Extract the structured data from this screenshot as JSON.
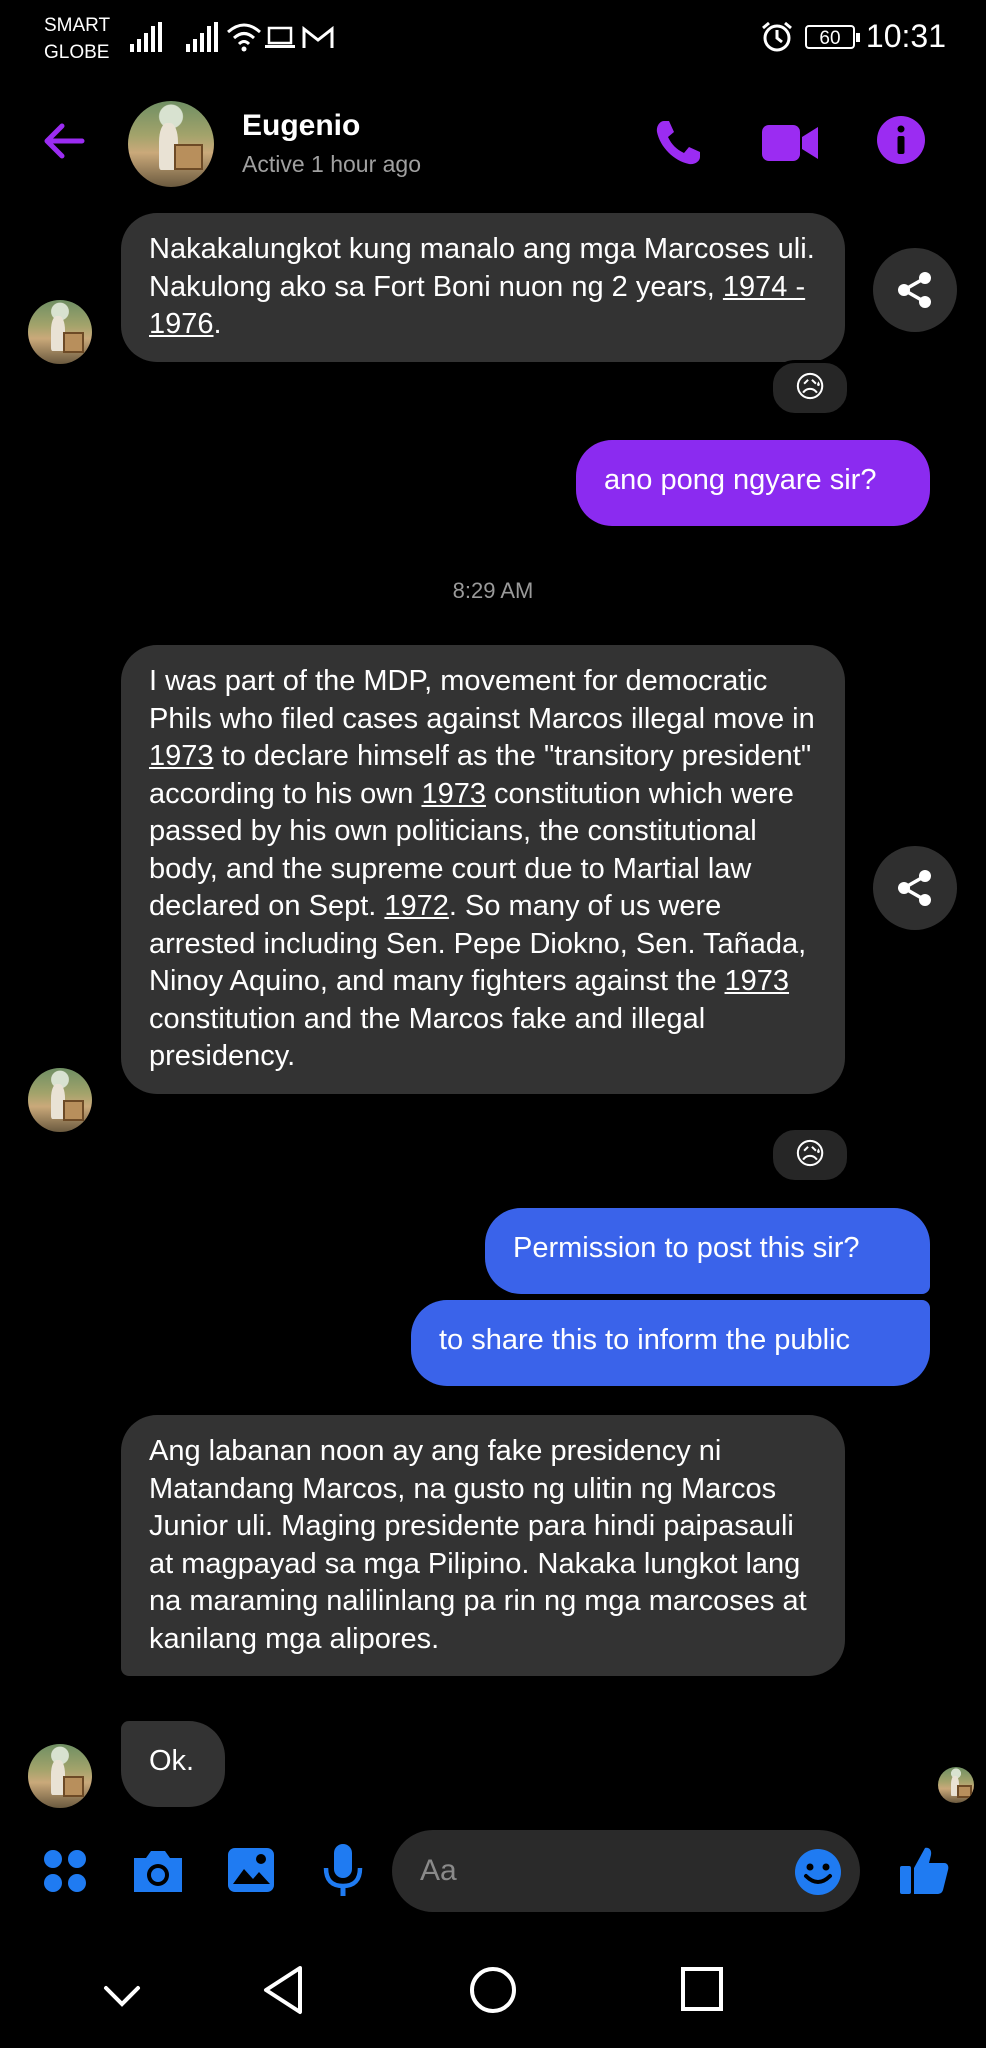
{
  "status_bar": {
    "carrier_line1": "SMART",
    "carrier_line2": "GLOBE",
    "battery": "60",
    "time": "10:31"
  },
  "header": {
    "contact_name": "Eugenio",
    "contact_status": "Active 1 hour ago",
    "accent_color": "#9b2cf2"
  },
  "messages": {
    "m1": {
      "parts": [
        "Nakakalungkot kung manalo ang mga Marcoses uli. Nakulong ako sa Fort Boni nuon ng 2 years, ",
        "1974 - 1976",
        "."
      ],
      "reaction": "😥"
    },
    "m2": {
      "text": "ano pong ngyare sir?"
    },
    "timestamp": "8:29 AM",
    "m3": {
      "parts": [
        "I was part of the MDP, movement for democratic Phils who filed cases against Marcos illegal move in ",
        "1973",
        " to declare himself as the \"transitory president\" according to his own ",
        "1973",
        " constitution which were passed by his own politicians, the constitutional body, and the supreme court due to Martial law declared on Sept. ",
        "1972",
        ". So many of us were arrested including Sen. Pepe Diokno, Sen. Tañada, Ninoy Aquino, and many fighters against the ",
        "1973",
        " constitution and the Marcos fake and illegal presidency."
      ],
      "reaction": "😥"
    },
    "m4": {
      "text": "Permission to post this sir?"
    },
    "m5": {
      "text": "to share this to inform the public"
    },
    "m6": {
      "text": "Ang labanan noon ay ang fake presidency ni Matandang Marcos, na gusto ng ulitin ng Marcos Junior uli. Maging presidente para hindi paipasauli at magpayad sa mga Pilipino. Nakaka lungkot lang na maraming nalilinlang pa rin ng mga marcoses at kanilang mga alipores."
    },
    "m7": {
      "text": "Ok."
    }
  },
  "composer": {
    "placeholder": "Aa",
    "icon_color": "#1f7bf2"
  },
  "icons": [
    "back-arrow-icon",
    "phone-icon",
    "video-icon",
    "info-icon",
    "share-icon",
    "apps-icon",
    "camera-icon",
    "gallery-icon",
    "mic-icon",
    "emoji-icon",
    "like-icon",
    "nav-down-icon",
    "nav-back-icon",
    "nav-home-icon",
    "nav-recents-icon"
  ]
}
